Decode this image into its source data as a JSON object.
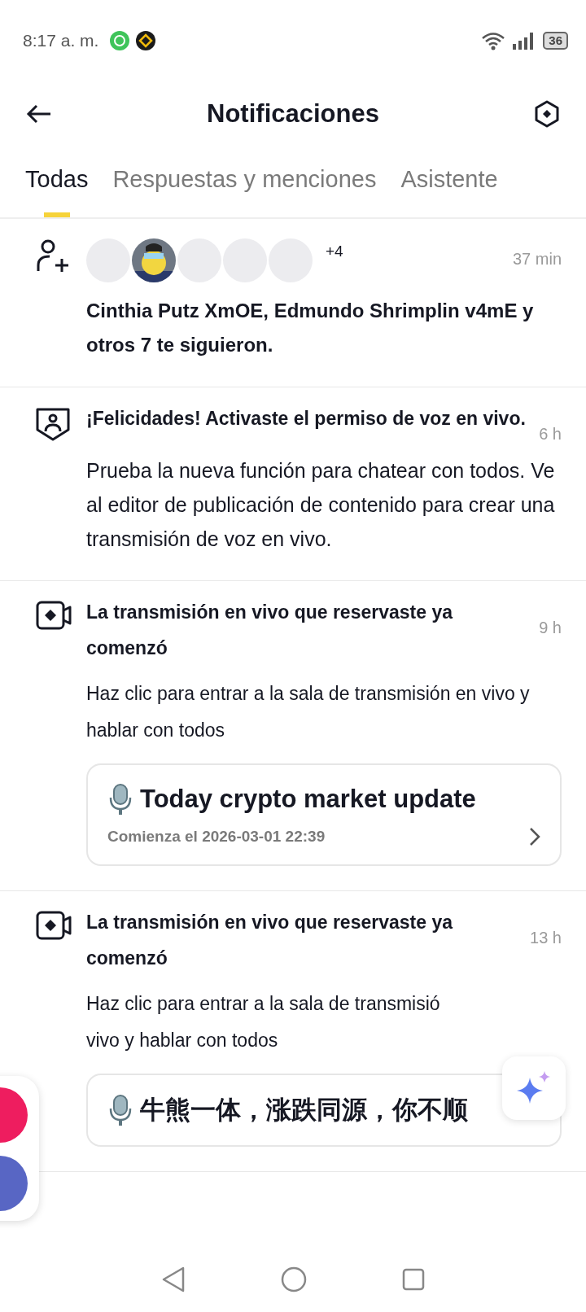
{
  "status_bar": {
    "time": "8:17 a. m.",
    "battery": "36"
  },
  "header": {
    "title": "Notificaciones"
  },
  "tabs": [
    {
      "label": "Todas",
      "selected": true
    },
    {
      "label": "Respuestas y menciones",
      "selected": false
    },
    {
      "label": "Asistente",
      "selected": false
    }
  ],
  "notifications": [
    {
      "kind": "follow",
      "time": "37 min",
      "avatars": [
        {
          "kind": "blank"
        },
        {
          "kind": "picture"
        },
        {
          "kind": "blank"
        },
        {
          "kind": "blank"
        },
        {
          "kind": "blank"
        }
      ],
      "more": "+4",
      "text": "Cinthia Putz XmOE, Edmundo Shrimplin v4mE y otros 7 te siguieron."
    },
    {
      "kind": "voice",
      "time": "6 h",
      "title": "¡Felicidades! Activaste el permiso de voz en vivo.",
      "body": "Prueba la nueva función para chatear con todos. Ve al editor de publicación de contenido para crear una transmisión de voz en vivo."
    },
    {
      "kind": "live",
      "time": "9 h",
      "title": "La transmisión en vivo que reservaste ya comenzó",
      "body": "Haz clic para entrar a la sala de transmisión en vivo y hablar con todos",
      "card": {
        "title": "Today crypto market update",
        "subtitle": "Comienza el 2026-03-01 22:39"
      }
    },
    {
      "kind": "live",
      "time": "13 h",
      "title": "La transmisión en vivo que reservaste ya comenzó",
      "body_lines": [
        "Haz clic para entrar a la sala de transmisió",
        "vivo y hablar con todos"
      ],
      "card": {
        "title": "牛熊一体，涨跌同源，你不顺"
      }
    }
  ]
}
